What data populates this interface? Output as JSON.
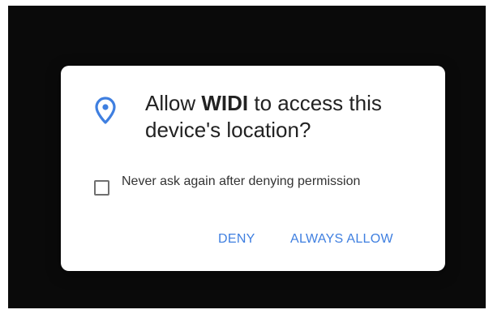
{
  "dialog": {
    "title_prefix": "Allow ",
    "app_name": "WIDI",
    "title_suffix": " to access this device's location?",
    "checkbox_label": "Never ask again after denying permission",
    "checkbox_checked": false,
    "deny_label": "DENY",
    "allow_label": "ALWAYS ALLOW",
    "icon": "location-pin-icon"
  },
  "colors": {
    "accent": "#3f7fe0",
    "background": "#0a0a0a",
    "dialog": "#ffffff"
  }
}
